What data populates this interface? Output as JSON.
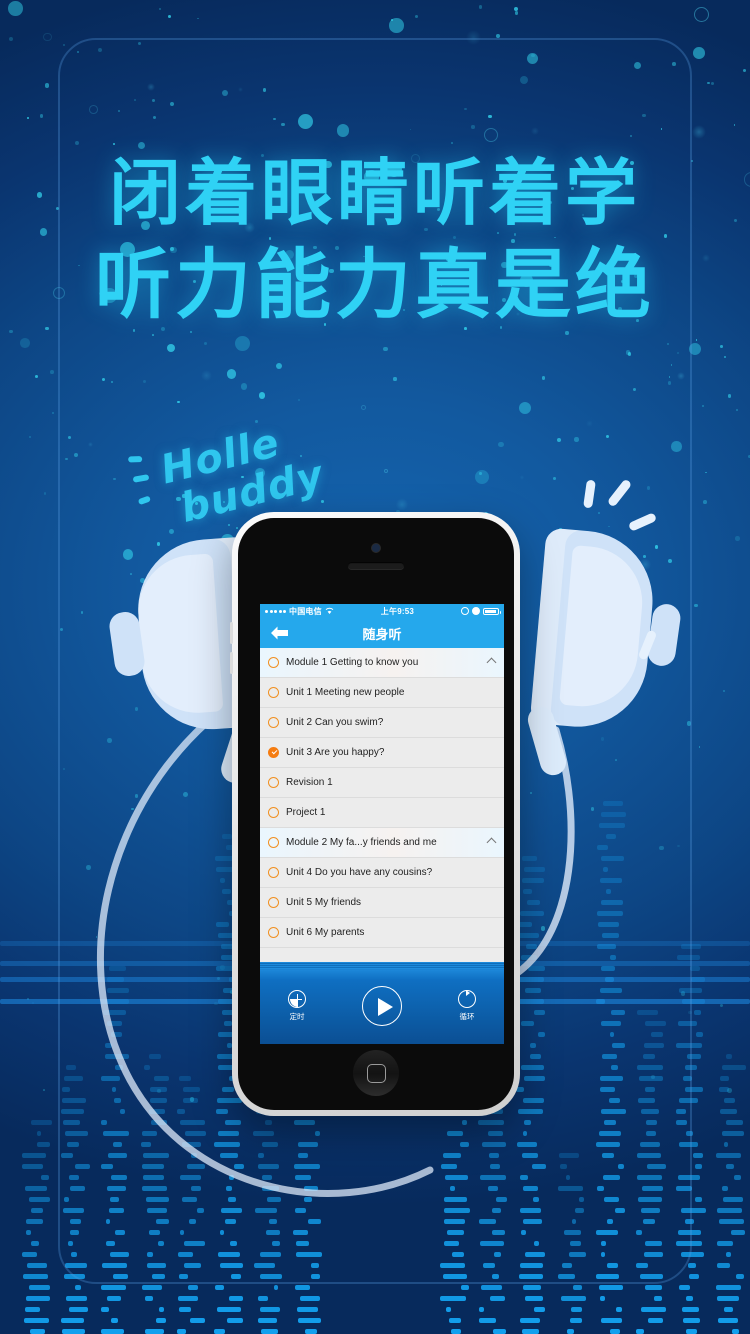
{
  "headline": {
    "line1": "闭着眼睛听着学",
    "line2": "听力能力真是绝"
  },
  "doodle": {
    "word1": "Holle",
    "word2": "buddy"
  },
  "phone": {
    "statusbar": {
      "carrier": "中国电信",
      "wifi_icon": "wifi-icon",
      "time": "上午9:53",
      "location_icon": "location-arrow-icon",
      "alarm_icon": "alarm-icon",
      "battery_icon": "battery-icon"
    },
    "navbar": {
      "back_icon": "back-arrow-icon",
      "title": "随身听"
    },
    "list": [
      {
        "type": "module",
        "label": "Module 1  Getting to know you",
        "state": "pending",
        "chevron": "chevron-up-icon"
      },
      {
        "type": "unit",
        "label": "Unit 1  Meeting new people",
        "state": "pending"
      },
      {
        "type": "unit",
        "label": "Unit 2  Can you swim?",
        "state": "pending"
      },
      {
        "type": "unit",
        "label": "Unit 3  Are you happy?",
        "state": "done"
      },
      {
        "type": "unit",
        "label": "Revision 1",
        "state": "pending"
      },
      {
        "type": "unit",
        "label": "Project 1",
        "state": "pending"
      },
      {
        "type": "module",
        "label": "Module 2  My fa...y friends and me",
        "state": "pending",
        "chevron": "chevron-up-icon"
      },
      {
        "type": "unit",
        "label": "Unit 4  Do you have any cousins?",
        "state": "pending"
      },
      {
        "type": "unit",
        "label": "Unit 5  My friends",
        "state": "pending"
      },
      {
        "type": "unit",
        "label": "Unit 6  My parents",
        "state": "pending"
      }
    ],
    "player": {
      "timer_label": "定时",
      "timer_icon": "clock-icon",
      "play_icon": "play-icon",
      "loop_label": "循环",
      "loop_icon": "loop-icon"
    }
  },
  "colors": {
    "background_blue": "#0d4685",
    "accent_cyan": "#2fd2f5",
    "nav_blue": "#25a8ec",
    "bullet_orange": "#f09022",
    "bullet_done_orange": "#f57c11",
    "headphone_light": "#cfe2f8"
  }
}
